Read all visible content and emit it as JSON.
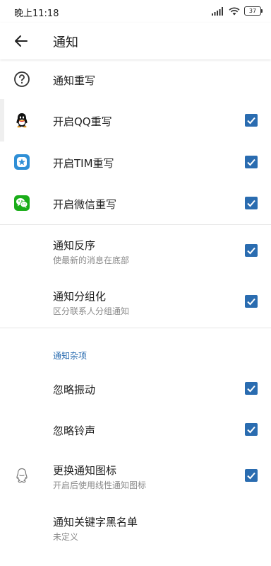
{
  "status_bar": {
    "time": "晚上11:18",
    "battery": "37",
    "icons": [
      "signal-icon",
      "wifi-icon",
      "battery-icon"
    ]
  },
  "app_bar": {
    "title": "通知",
    "back_icon": "arrow-left-icon"
  },
  "items": [
    {
      "id": "notify-rewrite",
      "title": "通知重写",
      "icon": "help-circle-icon"
    },
    {
      "id": "qq-rewrite",
      "title": "开启QQ重写",
      "icon": "qq-icon",
      "checked": true
    },
    {
      "id": "tim-rewrite",
      "title": "开启TIM重写",
      "icon": "tim-icon",
      "checked": true
    },
    {
      "id": "wechat-rewrite",
      "title": "开启微信重写",
      "icon": "wechat-icon",
      "checked": true
    },
    {
      "id": "reverse-order",
      "title": "通知反序",
      "subtitle": "使最新的消息在底部",
      "checked": true
    },
    {
      "id": "group-notify",
      "title": "通知分组化",
      "subtitle": "区分联系人分组通知",
      "checked": true
    }
  ],
  "misc_section": {
    "header": "通知杂项",
    "items": [
      {
        "id": "ignore-vibrate",
        "title": "忽略振动",
        "checked": true
      },
      {
        "id": "ignore-ringtone",
        "title": "忽略铃声",
        "checked": true
      },
      {
        "id": "change-icon",
        "title": "更换通知图标",
        "subtitle": "开启后使用线性通知图标",
        "icon": "qq-outline-icon",
        "checked": true
      },
      {
        "id": "keyword-blacklist",
        "title": "通知关键字黑名单",
        "subtitle": "未定义"
      }
    ]
  },
  "colors": {
    "accent": "#2a6cb0",
    "wechat": "#1aad19",
    "tim": "#2f8fd6"
  }
}
